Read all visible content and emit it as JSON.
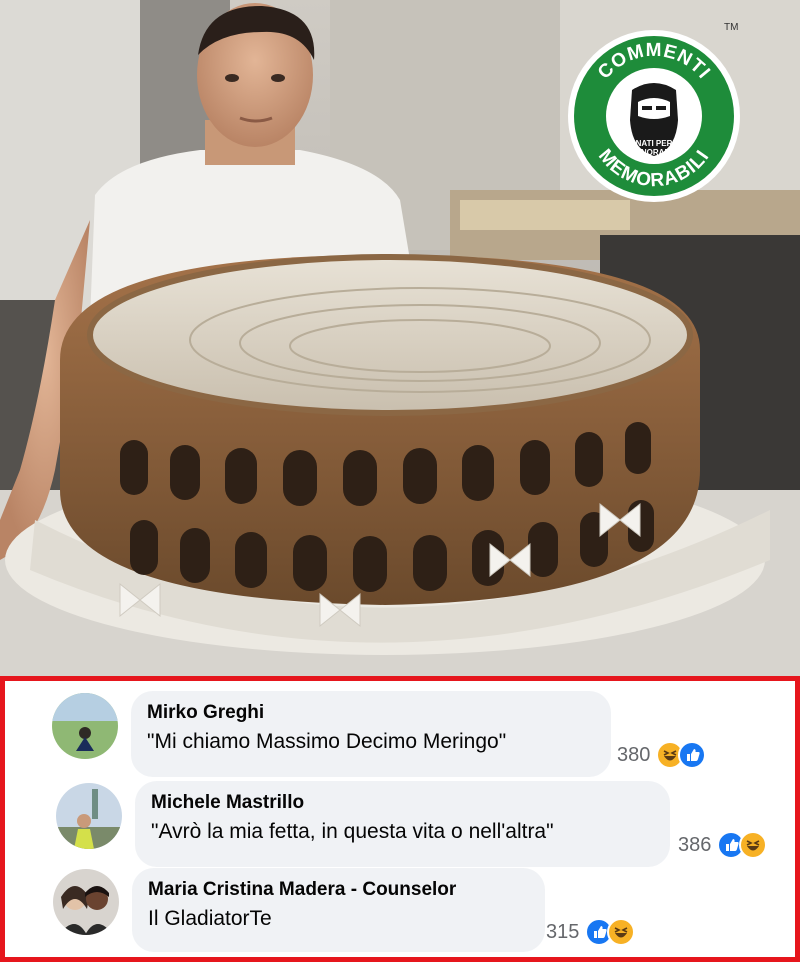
{
  "watermark": {
    "top_text": "COMMENTI",
    "bottom_text": "MEMORABILI",
    "tagline_1": "NATI PER",
    "tagline_2": "IGNORARE",
    "trademark": "TM",
    "colors": {
      "green": "#1e8c3a",
      "dark": "#1a1a1a"
    }
  },
  "comments": [
    {
      "author": "Mirko Greghi",
      "text": "\"Mi chiamo Massimo Decimo Meringo\"",
      "reaction_count": "380",
      "reactions": [
        "haha-icon",
        "like-icon"
      ]
    },
    {
      "author": "Michele Mastrillo",
      "text": "\"Avrò la mia fetta, in questa vita o nell'altra\"",
      "reaction_count": "386",
      "reactions": [
        "like-icon",
        "haha-icon"
      ]
    },
    {
      "author": "Maria Cristina Madera - Counselor",
      "text": "Il GladiatorTe",
      "reaction_count": "315",
      "reactions": [
        "like-icon",
        "haha-icon"
      ]
    }
  ],
  "colors": {
    "frame": "#e6161d",
    "bubble": "#f0f2f5",
    "like": "#1877f2",
    "haha": "#f7b125"
  }
}
